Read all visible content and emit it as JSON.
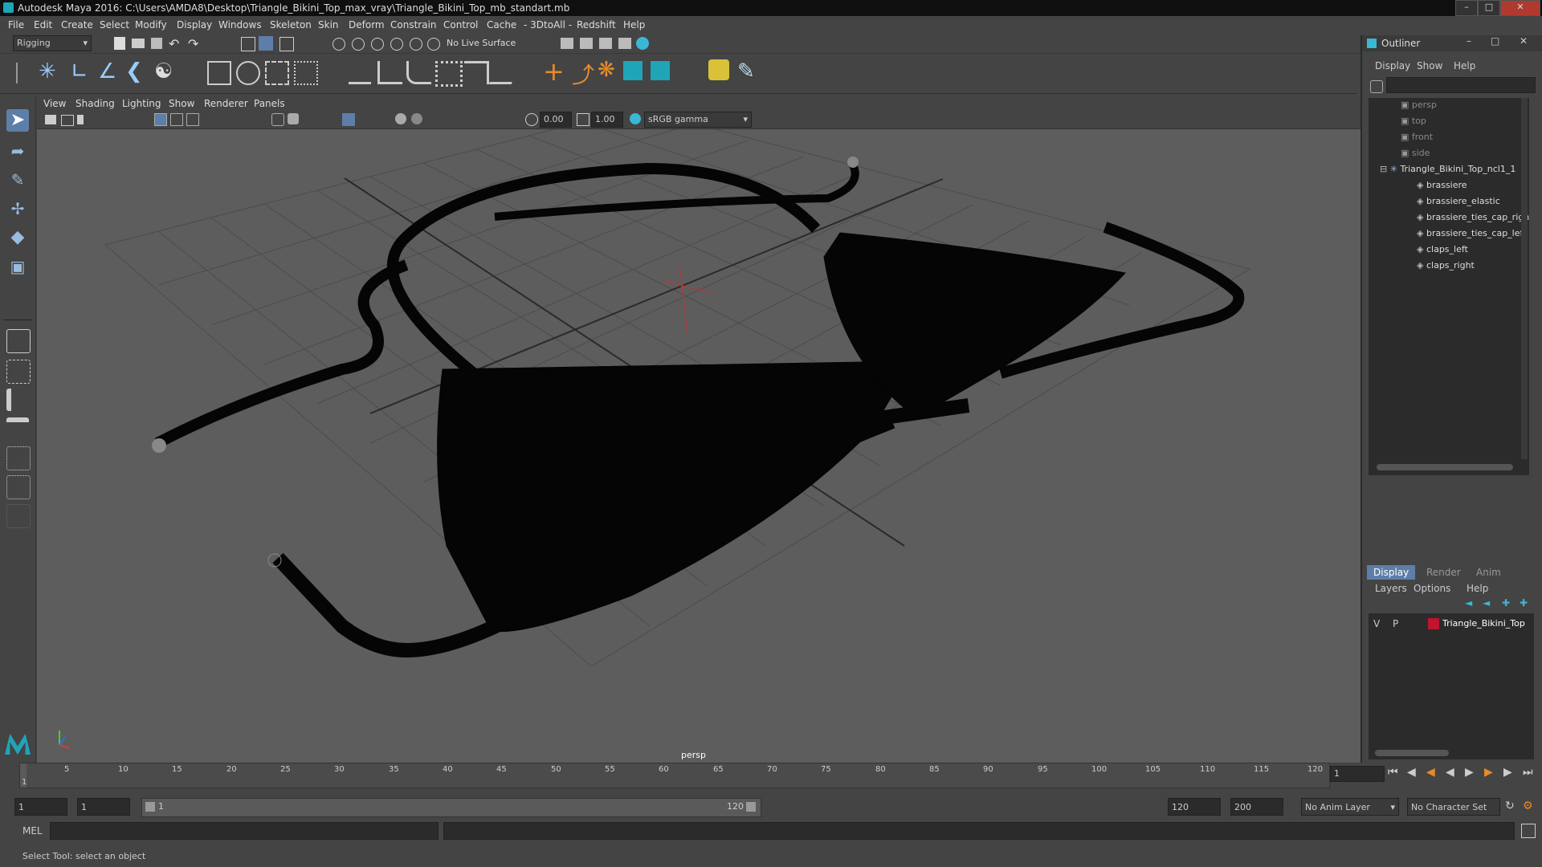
{
  "window": {
    "title": "Autodesk Maya 2016: C:\\Users\\AMDA8\\Desktop\\Triangle_Bikini_Top_max_vray\\Triangle_Bikini_Top_mb_standart.mb"
  },
  "menubar": [
    "File",
    "Edit",
    "Create",
    "Select",
    "Modify",
    "Display",
    "Windows",
    "Skeleton",
    "Skin",
    "Deform",
    "Constrain",
    "Control",
    "Cache",
    "- 3DtoAll -",
    "Redshift",
    "Help"
  ],
  "statusline": {
    "mode": "Rigging",
    "live_surface": "No Live Surface"
  },
  "panel_menu": [
    "View",
    "Shading",
    "Lighting",
    "Show",
    "Renderer",
    "Panels"
  ],
  "panel_toolbar": {
    "value_a": "0.00",
    "value_b": "1.00",
    "color_space": "sRGB gamma"
  },
  "viewport": {
    "camera_label": "persp"
  },
  "outliner": {
    "title": "Outliner",
    "menu": [
      "Display",
      "Show",
      "Help"
    ],
    "cameras": [
      "persp",
      "top",
      "front",
      "side"
    ],
    "group": "Triangle_Bikini_Top_ncl1_1",
    "children": [
      "brassiere",
      "brassiere_elastic",
      "brassiere_ties_cap_righ",
      "brassiere_ties_cap_left",
      "claps_left",
      "claps_right"
    ]
  },
  "layer_panel": {
    "tabs": [
      "Display",
      "Render",
      "Anim"
    ],
    "menu": [
      "Layers",
      "Options",
      "Help"
    ],
    "layer": {
      "v": "V",
      "p": "P",
      "name": "Triangle_Bikini_Top",
      "color": "#c0142f"
    }
  },
  "timeslider": {
    "ticks": [
      "5",
      "10",
      "15",
      "20",
      "25",
      "30",
      "35",
      "40",
      "45",
      "50",
      "55",
      "60",
      "65",
      "70",
      "75",
      "80",
      "85",
      "90",
      "95",
      "100",
      "105",
      "110",
      "115",
      "120"
    ],
    "current_marker": "1",
    "current_frame": "1"
  },
  "range": {
    "start": "1",
    "playback_start": "1",
    "slider_start": "1",
    "slider_end": "120",
    "playback_end": "120",
    "end": "200",
    "anim_layer": "No Anim Layer",
    "character_set": "No Character Set"
  },
  "command": {
    "lang": "MEL"
  },
  "help": {
    "text": "Select Tool: select an object"
  }
}
